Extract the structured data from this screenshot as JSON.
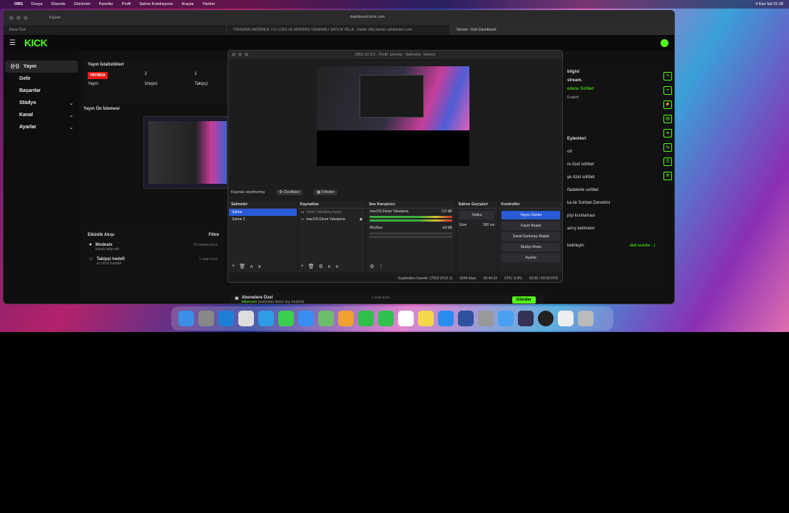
{
  "menubar": {
    "app": "OBS",
    "items": [
      "Dosya",
      "Düzenle",
      "Görünüm",
      "Paneller",
      "Profil",
      "Sahne Koleksiyonu",
      "Araçlar",
      "Yardım"
    ],
    "clock": "4 Kas Sal 01:28"
  },
  "browser": {
    "profile": "Kişisel",
    "url": "dashboard.kick.com",
    "tabs": [
      "Bana Özel",
      "TORKANA VADİSİNDE 7+1 LÜKS VE MODERN TASARIMLI SATILIK VİLLA - Sahibi Villa Ilanları sahibinden.com",
      "Stream - Kick Dashboard"
    ]
  },
  "kick": {
    "logo": "KICK",
    "sidebar": [
      {
        "label": "Yayın",
        "chev": ""
      },
      {
        "label": "Gelir",
        "chev": ""
      },
      {
        "label": "Başarılar",
        "chev": ""
      },
      {
        "label": "Stüdyo",
        "chev": "⌄"
      },
      {
        "label": "Kanal",
        "chev": "⌄"
      },
      {
        "label": "Ayarlar",
        "chev": "⌄"
      }
    ],
    "stats": {
      "title": "Yayın İstatistikleri",
      "live": "YAYINDA",
      "live_label": "Yayın",
      "viewers": "2",
      "viewers_label": "İzleyici",
      "followers": "1",
      "followers_label": "Takipçi"
    },
    "preview_title": "Yayın Ön İzlemesi",
    "activity": {
      "title": "Etkinlik Akışı",
      "filter": "Filtre",
      "rows": [
        {
          "name": "Modealx",
          "sub": "kanalı takip etti",
          "time": "53 dakika önce"
        },
        {
          "name": "Takipçi hedefi",
          "sub": "az önce başladı",
          "time": "1 saat önce"
        }
      ]
    },
    "right": {
      "lines": [
        "bilgisi",
        "stream.",
        "edece Sohbet",
        "English",
        "Eylemleri",
        "od",
        "re özel sohbet",
        "ye özel sohbet",
        "ifadelerle sohbet",
        "ka ile Sohbet Denetimi",
        "pişi kısıtlaması",
        "amış kelimeler",
        "belirleyin"
      ],
      "goal": "Aktif hedefler · 1"
    },
    "chat": {
      "subs": "Abonelere Özel",
      "subs_user": "altancans",
      "subs_text": "tarafından devre dışı bırakıldı",
      "subs_time": "1 saat önce",
      "send": "Gönder"
    }
  },
  "obs": {
    "title": "OBS 32.0.2 - Profil: İsimsiz - Sahneler: İsimsiz",
    "no_source": "Kaynak seçilmemiş",
    "props": "Özellikler",
    "filters": "Filtreler",
    "docks": {
      "scenes": {
        "title": "Sahneler",
        "items": [
          "Sahne",
          "Sahne 2"
        ]
      },
      "sources": {
        "title": "Kaynaklar",
        "items": [
          "Video Yakalama Aygıtı",
          "macOS Ekran Yakalama"
        ]
      },
      "mixer": {
        "title": "Ses Karıştırıcı",
        "ch1": "macOS Ekran Yakalama",
        "ch1_db": "0.0 dB",
        "ch2": "Mic/Aux",
        "ch2_db": "-inf dB"
      },
      "transitions": {
        "title": "Sahne Geçişleri",
        "type": "Soldur",
        "dur_label": "Süre",
        "dur": "300 ms"
      },
      "controls": {
        "title": "Kontroller",
        "buttons": [
          "Yayını Durdur",
          "Kaydı Başlat",
          "Sanal Kamerayı Başlat",
          "Stüdyo Modu",
          "Ayarlar"
        ]
      }
    },
    "status": {
      "dropped": "Kaybedilen Kareler 17023 (%12.1)",
      "bitrate": "9284 kbps",
      "time": "00:40:24",
      "cpu": "CPU: 9.9%",
      "fps": "60.00 / 60.00 FPS"
    }
  },
  "colors": {
    "kick_green": "#53fc18",
    "live_red": "#e91916",
    "obs_blue": "#2a5bd7"
  }
}
